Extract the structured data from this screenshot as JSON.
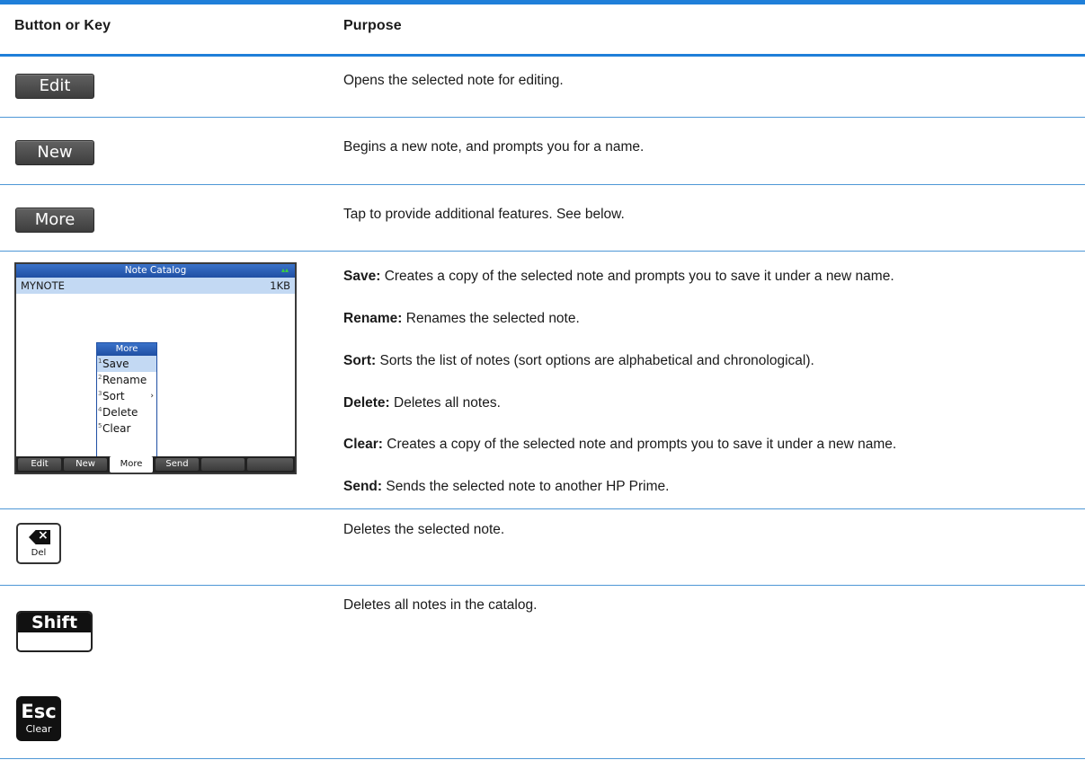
{
  "table": {
    "header": {
      "col1": "Button or Key",
      "col2": "Purpose"
    },
    "rows": [
      {
        "button": "Edit",
        "purpose": "Opens the selected note for editing."
      },
      {
        "button": "New",
        "purpose": "Begins a new note, and prompts you for a name."
      },
      {
        "button": "More",
        "purpose": "Tap to provide additional features. See below."
      }
    ],
    "more_items": [
      {
        "term": "Save:",
        "text": "Creates a copy of the selected note and prompts you to save it under a new name."
      },
      {
        "term": "Rename:",
        "text": "Renames the selected note."
      },
      {
        "term": "Sort:",
        "text": "Sorts the list of notes (sort options are alphabetical and chronological)."
      },
      {
        "term": "Delete:",
        "text": "Deletes all notes."
      },
      {
        "term": "Clear:",
        "text": "Creates a copy of the selected note and prompts you to save it under a new name."
      },
      {
        "term": "Send:",
        "text": "Sends the selected note to another HP Prime."
      }
    ],
    "del_purpose": "Deletes the selected note.",
    "shift_purpose": "Deletes all notes in the catalog."
  },
  "screenshot": {
    "title": "Note Catalog",
    "note_name": "MYNOTE",
    "note_size": "1KB",
    "menu_title": "More",
    "menu_items": [
      {
        "num": "1",
        "label": "Save"
      },
      {
        "num": "2",
        "label": "Rename"
      },
      {
        "num": "3",
        "label": "Sort"
      },
      {
        "num": "4",
        "label": "Delete"
      },
      {
        "num": "5",
        "label": "Clear"
      }
    ],
    "softkeys": [
      "Edit",
      "New",
      "More",
      "Send",
      "",
      ""
    ]
  },
  "keys": {
    "del_label": "Del",
    "shift_label": "Shift",
    "esc_top": "Esc",
    "esc_bottom": "Clear"
  },
  "colors": {
    "rule": "#1f7fd9",
    "screen_title": "#1f4fa3",
    "selection": "#c3d9f3"
  }
}
